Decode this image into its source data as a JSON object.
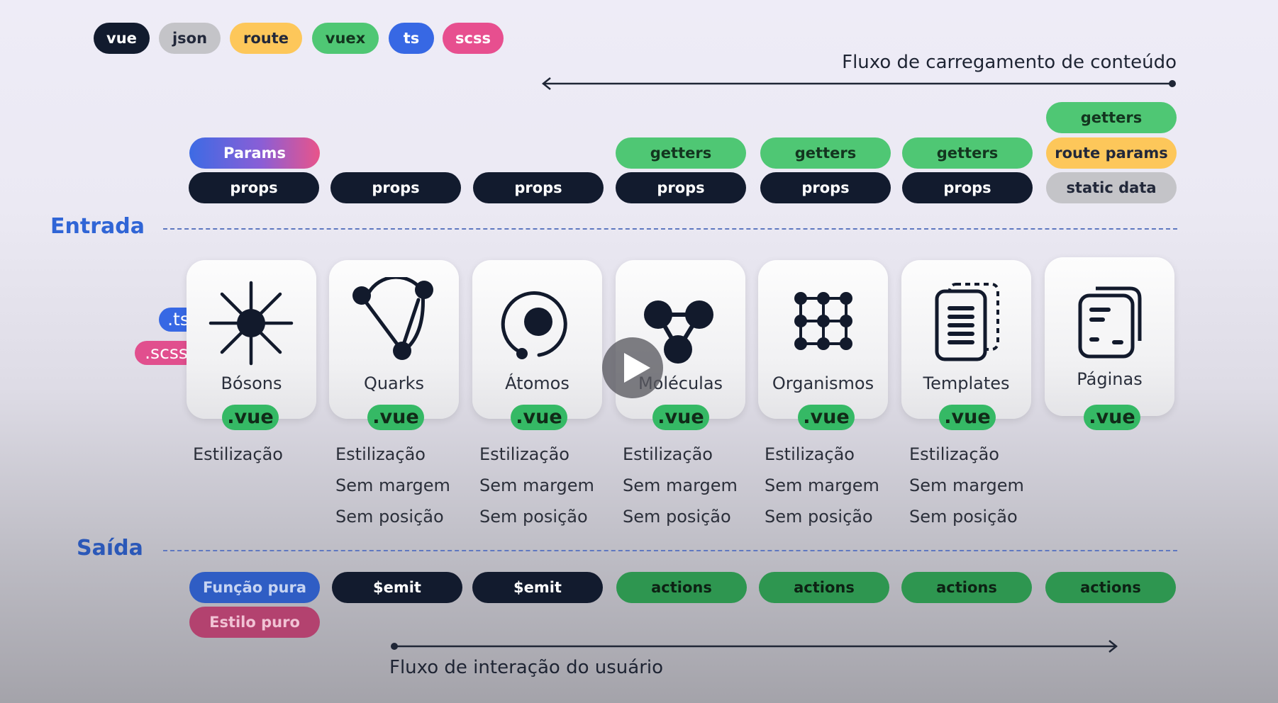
{
  "legend": [
    {
      "label": "vue",
      "cls": "c-vue"
    },
    {
      "label": "json",
      "cls": "c-json"
    },
    {
      "label": "route",
      "cls": "c-route"
    },
    {
      "label": "vuex",
      "cls": "c-vuex"
    },
    {
      "label": "ts",
      "cls": "c-ts"
    },
    {
      "label": "scss",
      "cls": "c-scss"
    }
  ],
  "load_flow_label": "Fluxo de carregamento de conteúdo",
  "interaction_flow_label": "Fluxo de interação do usuário",
  "input_label": "Entrada",
  "output_label": "Saída",
  "side_badges": {
    "ts": ".ts",
    "scss": ".scss"
  },
  "file_ext": ".vue",
  "columns": [
    {
      "name": "Bósons",
      "icon": "boson-icon",
      "inputs": [
        "Params",
        "props"
      ],
      "rules": [
        "Estilização"
      ],
      "outputs": [
        "Função pura",
        "Estilo puro"
      ]
    },
    {
      "name": "Quarks",
      "icon": "quark-icon",
      "inputs": [
        "props"
      ],
      "rules": [
        "Estilização",
        "Sem margem",
        "Sem posição"
      ],
      "outputs": [
        "$emit"
      ]
    },
    {
      "name": "Átomos",
      "icon": "atom-icon",
      "inputs": [
        "props"
      ],
      "rules": [
        "Estilização",
        "Sem margem",
        "Sem posição"
      ],
      "outputs": [
        "$emit"
      ]
    },
    {
      "name": "Moléculas",
      "icon": "molecule-icon",
      "inputs": [
        "getters",
        "props"
      ],
      "rules": [
        "Estilização",
        "Sem margem",
        "Sem posição"
      ],
      "outputs": [
        "actions"
      ]
    },
    {
      "name": "Organismos",
      "icon": "organism-icon",
      "inputs": [
        "getters",
        "props"
      ],
      "rules": [
        "Estilização",
        "Sem margem",
        "Sem posição"
      ],
      "outputs": [
        "actions"
      ]
    },
    {
      "name": "Templates",
      "icon": "template-icon",
      "inputs": [
        "getters",
        "props"
      ],
      "rules": [
        "Estilização",
        "Sem margem",
        "Sem posição"
      ],
      "outputs": [
        "actions"
      ]
    },
    {
      "name": "Páginas",
      "icon": "page-icon",
      "inputs": [
        "getters",
        "route params",
        "static data"
      ],
      "rules": [],
      "outputs": [
        "actions"
      ]
    }
  ],
  "colors": {
    "entrada": "#3065d6",
    "saida": "#2b58b8",
    "vue_badge": "#35b965"
  }
}
